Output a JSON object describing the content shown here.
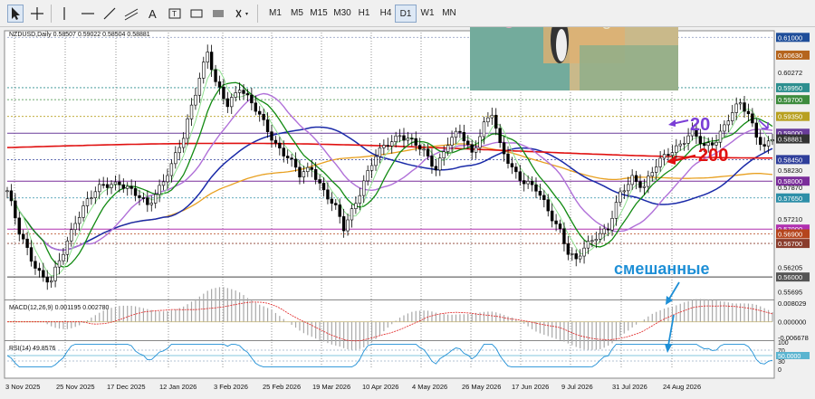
{
  "toolbar": {
    "timeframes": [
      "M1",
      "M5",
      "M15",
      "M30",
      "H1",
      "H4",
      "D1",
      "W1",
      "MN"
    ],
    "active_timeframe": "D1",
    "tools": [
      "cursor-icon",
      "crosshair-icon",
      "vertical-line-icon",
      "horizontal-line-icon",
      "trendline-icon",
      "channel-icon",
      "text-icon",
      "label-icon",
      "rectangle-icon",
      "shapes-icon"
    ]
  },
  "chart_data": [
    {
      "type": "line",
      "title": "NZDUSD,Daily",
      "ohlc": "0.58507 0.59022 0.58504 0.58881",
      "price_tick_labels": [
        "0.61000",
        "0.60630",
        "0.60272",
        "0.59950",
        "0.59700",
        "0.59350",
        "0.59000",
        "0.58881",
        "0.58450",
        "0.58230",
        "0.58000",
        "0.57870",
        "0.57650",
        "0.57210",
        "0.57000",
        "0.56900",
        "0.56700",
        "0.56205",
        "0.56000",
        "0.55695"
      ],
      "highlighted_price_labels": [
        {
          "value": "0.61000",
          "color": "#1f4e9a"
        },
        {
          "value": "0.60630",
          "color": "#b5651d"
        },
        {
          "value": "0.59950",
          "color": "#2d8f8f"
        },
        {
          "value": "0.59700",
          "color": "#3d8b3d"
        },
        {
          "value": "0.59350",
          "color": "#b8a020"
        },
        {
          "value": "0.59000",
          "color": "#6a3d9a"
        },
        {
          "value": "0.58881",
          "color": "#333333"
        },
        {
          "value": "0.58450",
          "color": "#2e3e9a"
        },
        {
          "value": "0.58000",
          "color": "#7a2d9a"
        },
        {
          "value": "0.57650",
          "color": "#2d8fa8"
        },
        {
          "value": "0.57000",
          "color": "#b030b0"
        },
        {
          "value": "0.56900",
          "color": "#b5451d"
        },
        {
          "value": "0.56700",
          "color": "#8a3d2d"
        },
        {
          "value": "0.56000",
          "color": "#555555"
        }
      ],
      "date_labels": [
        "3 Nov 2025",
        "25 Nov 2025",
        "17 Dec 2025",
        "12 Jan 2026",
        "3 Feb 2026",
        "25 Feb 2026",
        "19 Mar 2026",
        "10 Apr 2026",
        "4 May 2026",
        "26 May 2026",
        "17 Jun 2026",
        "9 Jul 2026",
        "31 Jul 2026",
        "24 Aug 2026"
      ],
      "ylim": [
        0.5555,
        0.611
      ],
      "grid": true,
      "series": [
        {
          "name": "20",
          "color": "#7b3fd6"
        },
        {
          "name": "200",
          "color": "#e01010"
        }
      ],
      "close_anchors": [
        [
          0,
          0.578
        ],
        [
          3,
          0.569
        ],
        [
          6,
          0.564
        ],
        [
          9,
          0.56
        ],
        [
          11,
          0.559
        ],
        [
          14,
          0.565
        ],
        [
          17,
          0.572
        ],
        [
          20,
          0.576
        ],
        [
          24,
          0.579
        ],
        [
          28,
          0.58
        ],
        [
          32,
          0.577
        ],
        [
          35,
          0.575
        ],
        [
          38,
          0.579
        ],
        [
          41,
          0.583
        ],
        [
          44,
          0.589
        ],
        [
          46,
          0.596
        ],
        [
          48,
          0.602
        ],
        [
          50,
          0.607
        ],
        [
          52,
          0.6
        ],
        [
          55,
          0.596
        ],
        [
          58,
          0.6
        ],
        [
          61,
          0.596
        ],
        [
          64,
          0.592
        ],
        [
          67,
          0.588
        ],
        [
          70,
          0.585
        ],
        [
          73,
          0.581
        ],
        [
          76,
          0.583
        ],
        [
          79,
          0.578
        ],
        [
          82,
          0.574
        ],
        [
          84,
          0.57
        ],
        [
          86,
          0.574
        ],
        [
          89,
          0.58
        ],
        [
          92,
          0.585
        ],
        [
          95,
          0.588
        ],
        [
          98,
          0.59
        ],
        [
          101,
          0.588
        ],
        [
          104,
          0.586
        ],
        [
          107,
          0.583
        ],
        [
          110,
          0.588
        ],
        [
          113,
          0.59
        ],
        [
          116,
          0.586
        ],
        [
          119,
          0.592
        ],
        [
          121,
          0.594
        ],
        [
          123,
          0.587
        ],
        [
          126,
          0.583
        ],
        [
          129,
          0.58
        ],
        [
          132,
          0.578
        ],
        [
          135,
          0.574
        ],
        [
          138,
          0.57
        ],
        [
          140,
          0.565
        ],
        [
          142,
          0.563
        ],
        [
          144,
          0.566
        ],
        [
          147,
          0.569
        ],
        [
          150,
          0.57
        ],
        [
          153,
          0.577
        ],
        [
          156,
          0.581
        ],
        [
          159,
          0.579
        ],
        [
          162,
          0.583
        ],
        [
          165,
          0.586
        ],
        [
          168,
          0.588
        ],
        [
          171,
          0.59
        ],
        [
          174,
          0.587
        ],
        [
          177,
          0.589
        ],
        [
          180,
          0.593
        ],
        [
          183,
          0.596
        ],
        [
          185,
          0.594
        ],
        [
          187,
          0.59
        ],
        [
          189,
          0.587
        ],
        [
          191,
          0.5888
        ]
      ],
      "horizontal_levels": [
        {
          "value": 0.61,
          "color": "#9aa6c8",
          "dash": "dot"
        },
        {
          "value": 0.5995,
          "color": "#2d8f8f",
          "dash": "dot"
        },
        {
          "value": 0.597,
          "color": "#3d8b3d",
          "dash": "dot"
        },
        {
          "value": 0.5935,
          "color": "#b8a020",
          "dash": "dot"
        },
        {
          "value": 0.59,
          "color": "#6a3d9a",
          "dash": "solid"
        },
        {
          "value": 0.5845,
          "color": "#2e3e9a",
          "dash": "dot"
        },
        {
          "value": 0.58,
          "color": "#7a2d9a",
          "dash": "solid"
        },
        {
          "value": 0.5765,
          "color": "#2d8fa8",
          "dash": "dot"
        },
        {
          "value": 0.57,
          "color": "#b030b0",
          "dash": "solid"
        },
        {
          "value": 0.569,
          "color": "#b5451d",
          "dash": "dot"
        },
        {
          "value": 0.567,
          "color": "#8a3d2d",
          "dash": "dot"
        },
        {
          "value": 0.56,
          "color": "#444444",
          "dash": "solid"
        }
      ],
      "annotations": [
        {
          "text": "20",
          "color": "#7b3fd6"
        },
        {
          "text": "200",
          "color": "#e01010"
        },
        {
          "text": "смешанные",
          "color": "#1e8fd6"
        }
      ]
    },
    {
      "type": "bar",
      "title": "MACD(12,26,9) 0.001195 0.002780",
      "tick_labels": [
        "0.008029",
        "0.000000",
        "-0.006678"
      ],
      "ylim": [
        -0.0075,
        0.0088
      ]
    },
    {
      "type": "line",
      "title": "RSI(14) 49.8576",
      "tick_labels": [
        "100",
        "70",
        "50.0000",
        "30",
        "0"
      ],
      "ylim": [
        0,
        100
      ]
    }
  ]
}
